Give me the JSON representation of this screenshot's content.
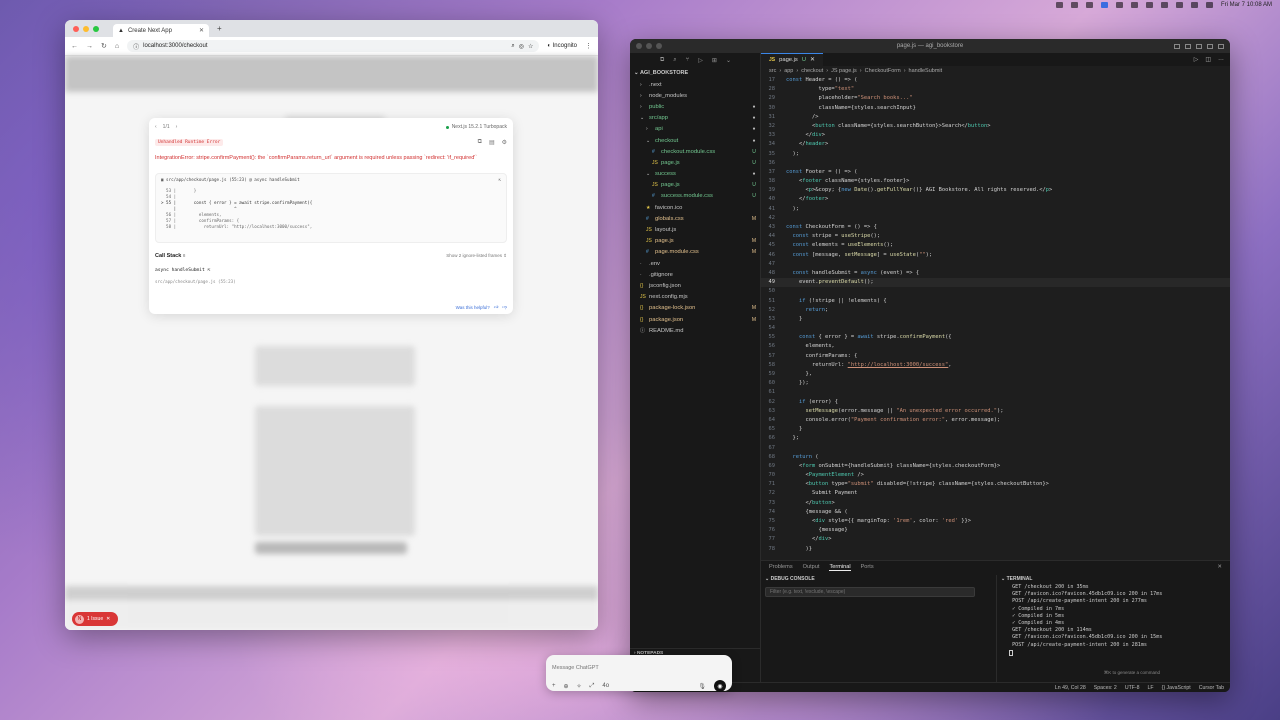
{
  "menubar": {
    "clock": "Fri Mar 7  10:08 AM"
  },
  "browser": {
    "tab_title": "Create Next App",
    "url": "localhost:3000/checkout",
    "incognito_label": "Incognito",
    "error": {
      "pager": "1/1",
      "nextjs_version": "Next.js 15.2.1 Turbopack",
      "kind": "Unhandled Runtime Error",
      "message": "IntegrationError: stripe.confirmPayment(): the `confirmParams.return_url` argument is required unless passing `redirect: 'if_required'`",
      "file": "src/app/checkout/page.js (55:23) @ async handleSubmit",
      "code_lines": [
        "  53 |       }",
        "  54 |",
        "> 55 |       const { error } = await stripe.confirmPayment({",
        "     |                       ^",
        "  56 |         elements,",
        "  57 |         confirmParams: {",
        "  58 |           returnUrl: \"http://localhost:3000/success\","
      ],
      "call_stack_title": "Call Stack",
      "call_stack_count": "8",
      "show_ignored": "Show 2 ignore-listed frames",
      "stack_fn": "async handleSubmit",
      "stack_src": "src/app/checkout/page.js (55:23)",
      "helpful": "Was this helpful?"
    },
    "issues": {
      "initial": "N",
      "label": "1 Issue"
    }
  },
  "vscode": {
    "title": "page.js — agi_bookstore",
    "explorer_root": "AGI_BOOKSTORE",
    "tree": [
      {
        "label": ".next",
        "indent": 1,
        "type": "folder",
        "state": ""
      },
      {
        "label": "node_modules",
        "indent": 1,
        "type": "folder",
        "state": ""
      },
      {
        "label": "public",
        "indent": 1,
        "type": "folder",
        "state": "dot"
      },
      {
        "label": "src/app",
        "indent": 1,
        "type": "folder-open",
        "state": "dot"
      },
      {
        "label": "api",
        "indent": 2,
        "type": "folder",
        "state": "dot"
      },
      {
        "label": "checkout",
        "indent": 2,
        "type": "folder-open",
        "state": "dot"
      },
      {
        "label": "checkout.module.css",
        "indent": 3,
        "type": "css",
        "state": "U"
      },
      {
        "label": "page.js",
        "indent": 3,
        "type": "js",
        "state": "U"
      },
      {
        "label": "success",
        "indent": 2,
        "type": "folder-open",
        "state": "dot"
      },
      {
        "label": "page.js",
        "indent": 3,
        "type": "js",
        "state": "U"
      },
      {
        "label": "success.module.css",
        "indent": 3,
        "type": "css",
        "state": "U"
      },
      {
        "label": "favicon.ico",
        "indent": 2,
        "type": "ico",
        "state": ""
      },
      {
        "label": "globals.css",
        "indent": 2,
        "type": "css",
        "state": "M"
      },
      {
        "label": "layout.js",
        "indent": 2,
        "type": "js",
        "state": ""
      },
      {
        "label": "page.js",
        "indent": 2,
        "type": "js",
        "state": "M"
      },
      {
        "label": "page.module.css",
        "indent": 2,
        "type": "css",
        "state": "M"
      },
      {
        "label": ".env",
        "indent": 1,
        "type": "file",
        "state": ""
      },
      {
        "label": ".gitignore",
        "indent": 1,
        "type": "file",
        "state": ""
      },
      {
        "label": "jsconfig.json",
        "indent": 1,
        "type": "json",
        "state": ""
      },
      {
        "label": "next.config.mjs",
        "indent": 1,
        "type": "js",
        "state": ""
      },
      {
        "label": "package-lock.json",
        "indent": 1,
        "type": "json",
        "state": "M"
      },
      {
        "label": "package.json",
        "indent": 1,
        "type": "json",
        "state": "M"
      },
      {
        "label": "README.md",
        "indent": 1,
        "type": "md",
        "state": ""
      }
    ],
    "notepads": "NOTEPADS",
    "tab": {
      "file": "page.js",
      "badge": "U"
    },
    "breadcrumb": [
      "src",
      "app",
      "checkout",
      "JS page.js",
      "CheckoutForm",
      "handleSubmit"
    ],
    "code": [
      {
        "n": "17",
        "t": "const Header = () => ("
      },
      {
        "n": "28",
        "t": "          type=\"text\""
      },
      {
        "n": "29",
        "t": "          placeholder=\"Search books...\""
      },
      {
        "n": "30",
        "t": "          className={styles.searchInput}"
      },
      {
        "n": "31",
        "t": "        />"
      },
      {
        "n": "32",
        "t": "        <button className={styles.searchButton}>Search</button>"
      },
      {
        "n": "33",
        "t": "      </div>"
      },
      {
        "n": "34",
        "t": "    </header>"
      },
      {
        "n": "35",
        "t": "  );"
      },
      {
        "n": "36",
        "t": ""
      },
      {
        "n": "37",
        "t": "const Footer = () => ("
      },
      {
        "n": "38",
        "t": "    <footer className={styles.footer}>"
      },
      {
        "n": "39",
        "t": "      <p>&copy; {new Date().getFullYear()} AGI Bookstore. All rights reserved.</p>"
      },
      {
        "n": "40",
        "t": "    </footer>"
      },
      {
        "n": "41",
        "t": "  );"
      },
      {
        "n": "42",
        "t": ""
      },
      {
        "n": "43",
        "t": "const CheckoutForm = () => {"
      },
      {
        "n": "44",
        "t": "  const stripe = useStripe();"
      },
      {
        "n": "45",
        "t": "  const elements = useElements();"
      },
      {
        "n": "46",
        "t": "  const [message, setMessage] = useState(\"\");"
      },
      {
        "n": "47",
        "t": ""
      },
      {
        "n": "48",
        "t": "  const handleSubmit = async (event) => {"
      },
      {
        "n": "49",
        "t": "    event.preventDefault();"
      },
      {
        "n": "50",
        "t": ""
      },
      {
        "n": "51",
        "t": "    if (!stripe || !elements) {"
      },
      {
        "n": "52",
        "t": "      return;"
      },
      {
        "n": "53",
        "t": "    }"
      },
      {
        "n": "54",
        "t": ""
      },
      {
        "n": "55",
        "t": "    const { error } = await stripe.confirmPayment({"
      },
      {
        "n": "56",
        "t": "      elements,"
      },
      {
        "n": "57",
        "t": "      confirmParams: {"
      },
      {
        "n": "58",
        "t": "        returnUrl: \"http://localhost:3000/success\","
      },
      {
        "n": "59",
        "t": "      },"
      },
      {
        "n": "60",
        "t": "    });"
      },
      {
        "n": "61",
        "t": ""
      },
      {
        "n": "62",
        "t": "    if (error) {"
      },
      {
        "n": "63",
        "t": "      setMessage(error.message || \"An unexpected error occurred.\");"
      },
      {
        "n": "64",
        "t": "      console.error(\"Payment confirmation error:\", error.message);"
      },
      {
        "n": "65",
        "t": "    }"
      },
      {
        "n": "66",
        "t": "  };"
      },
      {
        "n": "67",
        "t": ""
      },
      {
        "n": "68",
        "t": "  return ("
      },
      {
        "n": "69",
        "t": "    <form onSubmit={handleSubmit} className={styles.checkoutForm}>"
      },
      {
        "n": "70",
        "t": "      <PaymentElement />"
      },
      {
        "n": "71",
        "t": "      <button type=\"submit\" disabled={!stripe} className={styles.checkoutButton}>"
      },
      {
        "n": "72",
        "t": "        Submit Payment"
      },
      {
        "n": "73",
        "t": "      </button>"
      },
      {
        "n": "74",
        "t": "      {message && ("
      },
      {
        "n": "75",
        "t": "        <div style={{ marginTop: '1rem', color: 'red' }}>"
      },
      {
        "n": "76",
        "t": "          {message}"
      },
      {
        "n": "77",
        "t": "        </div>"
      },
      {
        "n": "78",
        "t": "      )}"
      }
    ],
    "active_line": "49",
    "panel_tabs": [
      "Problems",
      "Output",
      "Terminal",
      "Ports"
    ],
    "panel_active": "Terminal",
    "debug_title": "DEBUG CONSOLE",
    "debug_filter_placeholder": "Filter (e.g. text, !exclude, \\escape)",
    "terminal_title": "TERMINAL",
    "terminal_lines": [
      " GET /checkout 200 in 35ms",
      " GET /favicon.ico?favicon.45db1c09.ico 200 in 17ms",
      " POST /api/create-payment-intent 200 in 277ms",
      " ✓ Compiled in 7ms",
      " ✓ Compiled in 5ms",
      " ✓ Compiled in 4ms",
      " GET /checkout 200 in 114ms",
      " GET /favicon.ico?favicon.45db1c09.ico 200 in 15ms",
      " POST /api/create-payment-intent 200 in 281ms"
    ],
    "terminal_hint": "⌘K to generate a command",
    "status": [
      "Ln 49, Col 28",
      "Spaces: 2",
      "UTF-8",
      "LF",
      "{} JavaScript",
      "Cursor Tab"
    ]
  },
  "chatgpt": {
    "placeholder": "Message ChatGPT",
    "model": "4o"
  }
}
